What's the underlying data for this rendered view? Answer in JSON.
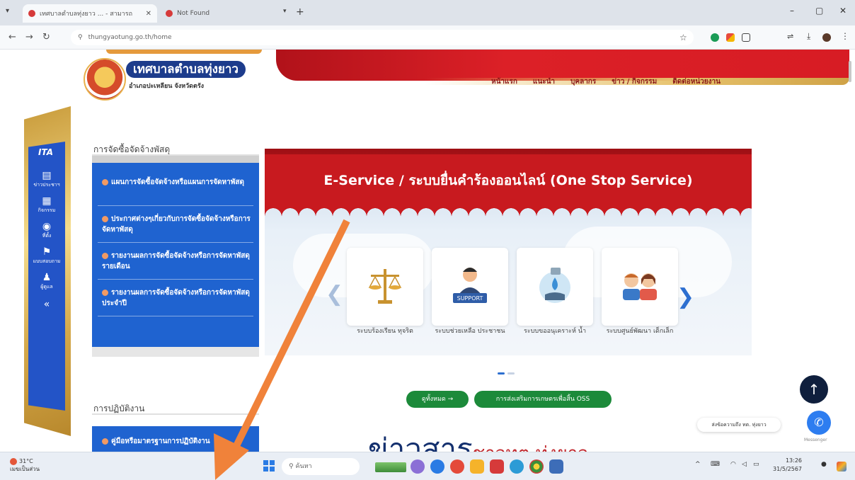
{
  "browser": {
    "tabs": [
      {
        "title": "เทศบาลตำบลทุ่งยาว ... - สามารถ",
        "active": true
      },
      {
        "title": "Not Found",
        "active": false
      }
    ],
    "url": "thungyaotung.go.th/home",
    "window_controls": {
      "minimize": "–",
      "maximize": "▢",
      "close": "✕"
    }
  },
  "site": {
    "name": "เทศบาลตำบลทุ่งยาว",
    "subtitle": "อำเภอปะเหลียน จังหวัดตรัง",
    "nav": [
      "หน้าแรก",
      "แนะนำ",
      "บุคลากร",
      "ข่าว / กิจกรรม",
      "ติดต่อหน่วยงาน"
    ]
  },
  "ita_sidebar": {
    "logo": "ITA",
    "items": [
      {
        "icon": "news-icon",
        "glyph": "▤",
        "label": "ข่าวประชาฯ"
      },
      {
        "icon": "calendar-icon",
        "glyph": "▦",
        "label": "กิจกรรม"
      },
      {
        "icon": "location-icon",
        "glyph": "◉",
        "label": "ที่ตั้ง"
      },
      {
        "icon": "flag-icon",
        "glyph": "⚑",
        "label": "แบบสอบถาม"
      },
      {
        "icon": "person-icon",
        "glyph": "♟",
        "label": "ผู้ดูแล"
      },
      {
        "icon": "collapse-icon",
        "glyph": "«",
        "label": ""
      }
    ]
  },
  "procurement": {
    "title": "การจัดซื้อจัดจ้างพัสดุ",
    "items": [
      "แผนการจัดซื้อจัดจ้างหรือแผนการจัดหาพัสดุ",
      "ประกาศต่างๆเกี่ยวกับการจัดซื้อจัดจ้างหรือการจัดหาพัสดุ",
      "รายงานผลการจัดซื้อจัดจ้างหรือการจัดหาพัสดุรายเดือน",
      "รายงานผลการจัดซื้อจัดจ้างหรือการจัดหาพัสดุประจำปี"
    ]
  },
  "operations": {
    "title": "การปฏิบัติงาน",
    "items": [
      "คู่มือหรือมาตรฐานการปฏิบัติงาน"
    ]
  },
  "eservice": {
    "title": "E-Service / ระบบยื่นคำร้องออนไลน์ (One Stop Service)",
    "cards": [
      {
        "icon": "scales-icon",
        "label": "ระบบร้องเรียน ทุจริต"
      },
      {
        "icon": "support-icon",
        "label": "ระบบช่วยเหลือ ประชาชน",
        "badge": "SUPPORT"
      },
      {
        "icon": "water-icon",
        "label": "ระบบขออนุเคราะห์ น้ำ"
      },
      {
        "icon": "kids-icon",
        "label": "ระบบศูนย์พัฒนา เด็กเล็ก"
      }
    ],
    "buttons": [
      "ดูทั้งหมด →",
      "การส่งเสริมการเกษตรเพื่อสิ้น OSS"
    ]
  },
  "news": {
    "title_main": "ข่าวสาร",
    "title_sub": "ชาวทต.ทุ่งยาว"
  },
  "floating": {
    "up": "↑",
    "chat_text": "ส่งข้อความถึง ทต. ทุ่งยาว",
    "messenger_label": "Messenger"
  },
  "taskbar": {
    "weather_temp": "31°C",
    "weather_desc": "เมฆเป็นส่วน",
    "search_placeholder": "ค้นหา",
    "clock_time": "13:26",
    "clock_date": "31/5/2567"
  },
  "colors": {
    "brand_red": "#d71c24",
    "brand_blue": "#1f63d0",
    "nav_blue": "#1d3c8c",
    "pill_green": "#1c8a3a",
    "annotation_orange": "#f0823a"
  }
}
